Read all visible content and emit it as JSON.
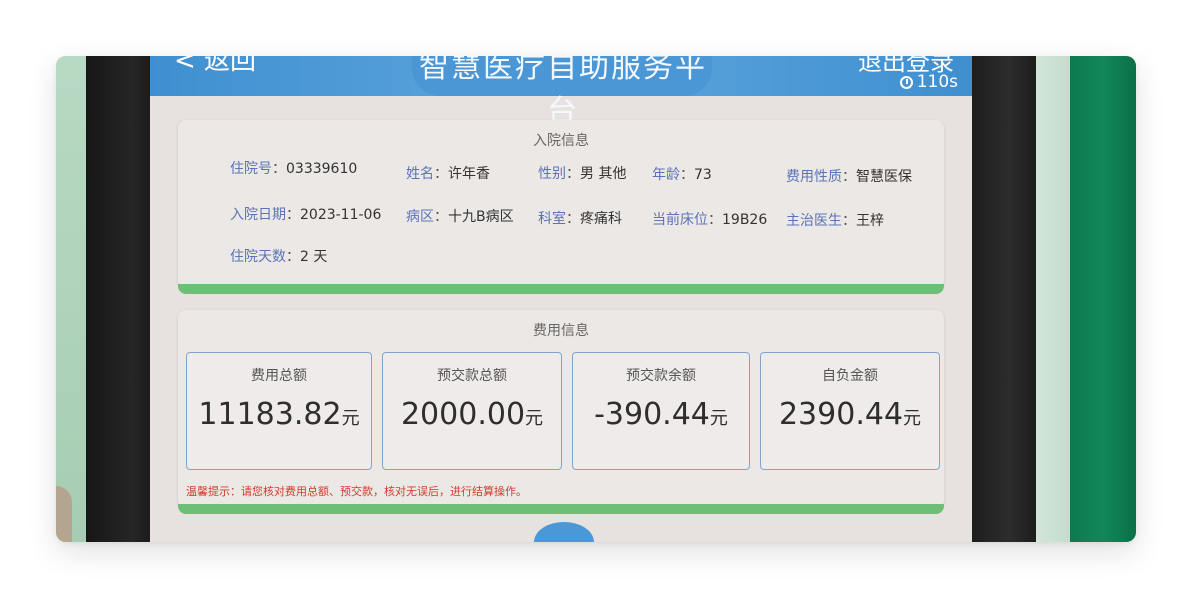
{
  "header": {
    "back": "< 返回",
    "title": "智慧医疗自助服务平台",
    "exit": "退出登录",
    "countdown": "110s"
  },
  "admission": {
    "title": "入院信息",
    "fields": [
      {
        "label": "住院号",
        "value": "03339610"
      },
      {
        "label": "姓名",
        "value": "许年香"
      },
      {
        "label": "性别",
        "value": "男 其他"
      },
      {
        "label": "年龄",
        "value": "73"
      },
      {
        "label": "费用性质",
        "value": "智慧医保"
      },
      {
        "label": "入院日期",
        "value": "2023-11-06"
      },
      {
        "label": "病区",
        "value": "十九B病区"
      },
      {
        "label": "科室",
        "value": "疼痛科"
      },
      {
        "label": "当前床位",
        "value": "19B26"
      },
      {
        "label": "主治医生",
        "value": "王梓"
      },
      {
        "label": "住院天数",
        "value": "2 天"
      }
    ]
  },
  "fees": {
    "title": "费用信息",
    "unit": "元",
    "cards": [
      {
        "label": "费用总额",
        "amount": "11183.82"
      },
      {
        "label": "预交款总额",
        "amount": "2000.00"
      },
      {
        "label": "预交款余额",
        "amount": "-390.44"
      },
      {
        "label": "自负金额",
        "amount": "2390.44"
      }
    ],
    "tip": "温馨提示：请您核对费用总额、预交款，核对无误后，进行结算操作。"
  },
  "colors": {
    "accent_blue": "#4a98d8",
    "label_blue": "#5b73b8",
    "panel_green": "#6dbf76",
    "tip_red": "#d33a2c"
  }
}
